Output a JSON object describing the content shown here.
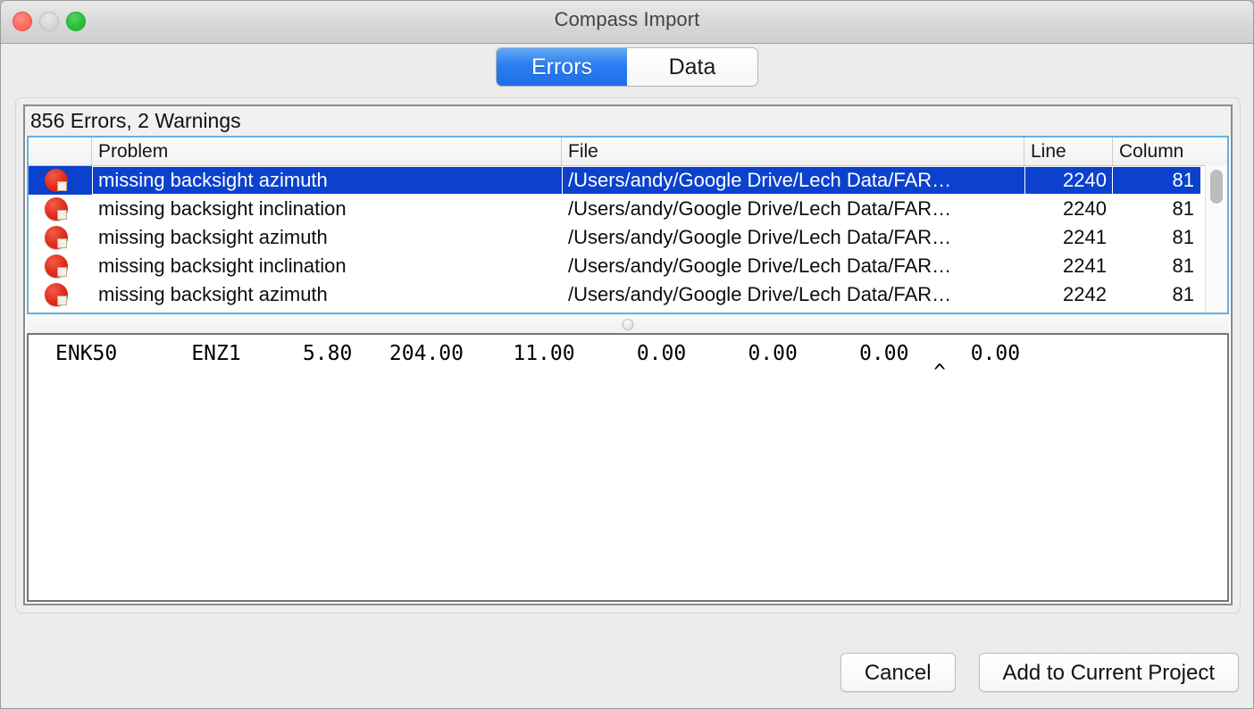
{
  "window": {
    "title": "Compass Import",
    "traffic_lights": [
      "close",
      "minimize",
      "maximize"
    ]
  },
  "tabs": [
    {
      "label": "Errors",
      "selected": true
    },
    {
      "label": "Data",
      "selected": false
    }
  ],
  "summary": "856 Errors, 2 Warnings",
  "table": {
    "headers": {
      "icon": "",
      "problem": "Problem",
      "file": "File",
      "line": "Line",
      "column": "Column"
    },
    "rows": [
      {
        "icon": "error-icon",
        "problem": "missing backsight azimuth",
        "file": "/Users/andy/Google Drive/Lech Data/FAR…",
        "line": "2240",
        "column": "81",
        "selected": true
      },
      {
        "icon": "error-icon",
        "problem": "missing backsight inclination",
        "file": "/Users/andy/Google Drive/Lech Data/FAR…",
        "line": "2240",
        "column": "81",
        "selected": false
      },
      {
        "icon": "error-icon",
        "problem": "missing backsight azimuth",
        "file": "/Users/andy/Google Drive/Lech Data/FAR…",
        "line": "2241",
        "column": "81",
        "selected": false
      },
      {
        "icon": "error-icon",
        "problem": "missing backsight inclination",
        "file": "/Users/andy/Google Drive/Lech Data/FAR…",
        "line": "2241",
        "column": "81",
        "selected": false
      },
      {
        "icon": "error-icon",
        "problem": "missing backsight azimuth",
        "file": "/Users/andy/Google Drive/Lech Data/FAR…",
        "line": "2242",
        "column": "81",
        "selected": false
      }
    ]
  },
  "data_preview": {
    "line": "ENK50      ENZ1     5.80   204.00    11.00     0.00     0.00     0.00     0.00",
    "caret": "                                                                       ^"
  },
  "footer": {
    "cancel_label": "Cancel",
    "add_label": "Add to Current Project"
  },
  "colors": {
    "accent_blue": "#2b7ef0",
    "selection_blue": "#0b41cd",
    "focus_border": "#64b0e8",
    "error_red": "#e02a18",
    "window_bg": "#ececec"
  }
}
